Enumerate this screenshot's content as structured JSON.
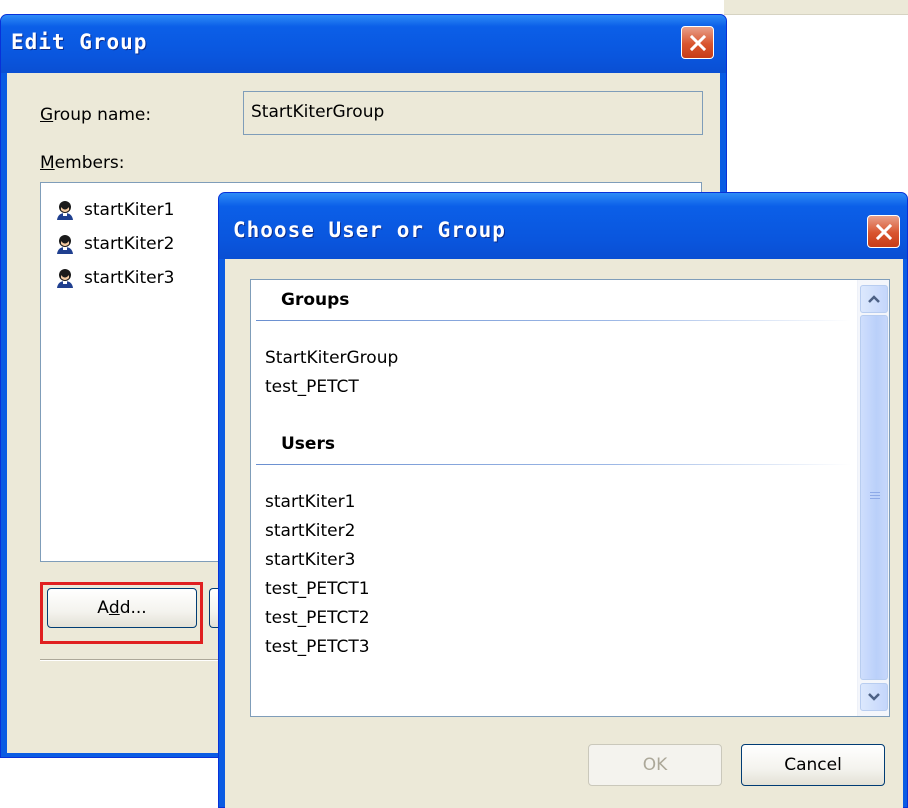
{
  "edit_group": {
    "title": "Edit Group",
    "group_name_label_prefix": "G",
    "group_name_label_rest": "roup name:",
    "group_name_value": "StartKiterGroup",
    "members_label_prefix": "M",
    "members_label_rest": "embers:",
    "members": [
      "startKiter1",
      "startKiter2",
      "startKiter3"
    ],
    "add_button": {
      "pre": "A",
      "accel": "d",
      "post": "d..."
    }
  },
  "choose_dialog": {
    "title": "Choose User or Group",
    "groups_heading": "Groups",
    "groups": [
      "StartKiterGroup",
      "test_PETCT"
    ],
    "users_heading": "Users",
    "users": [
      "startKiter1",
      "startKiter2",
      "startKiter3",
      "test_PETCT1",
      "test_PETCT2",
      "test_PETCT3"
    ],
    "ok_label": "OK",
    "cancel_label": "Cancel"
  },
  "colors": {
    "titlebar": "#0a5ce3",
    "window_face": "#ece9d8",
    "highlight": "#e02020",
    "close_button": "#d9552e"
  },
  "icons": {
    "member": "user-icon",
    "close": "close-icon",
    "scroll_up": "chevron-up-icon",
    "scroll_down": "chevron-down-icon"
  }
}
